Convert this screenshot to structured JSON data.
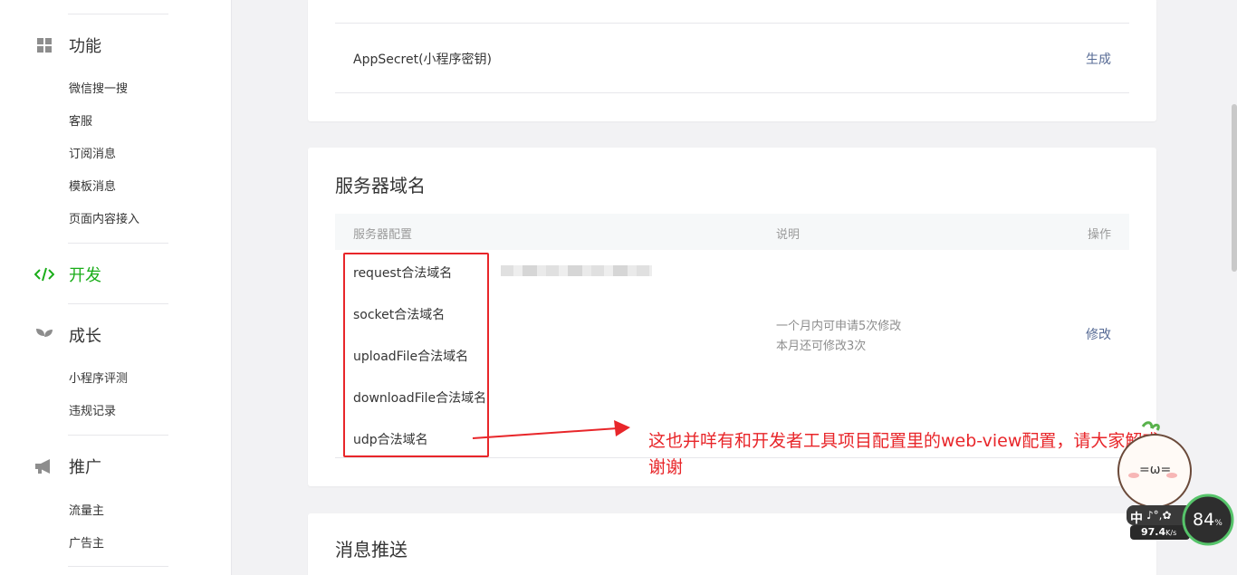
{
  "sidebar": {
    "sections": [
      {
        "label": "功能",
        "icon": "grid-icon"
      },
      {
        "label": "开发",
        "icon": "code-icon"
      },
      {
        "label": "成长",
        "icon": "sprout-icon"
      },
      {
        "label": "推广",
        "icon": "megaphone-icon"
      }
    ],
    "function_items": [
      "微信搜一搜",
      "客服",
      "订阅消息",
      "模板消息",
      "页面内容接入"
    ],
    "growth_items": [
      "小程序评测",
      "违规记录"
    ],
    "promo_items": [
      "流量主",
      "广告主"
    ]
  },
  "developer_settings": {
    "appsecret_label": "AppSecret(小程序密钥)",
    "generate_link": "生成"
  },
  "server_domain": {
    "title": "服务器域名",
    "headers": {
      "config": "服务器配置",
      "desc": "说明",
      "action": "操作"
    },
    "rows": [
      "request合法域名",
      "socket合法域名",
      "uploadFile合法域名",
      "downloadFile合法域名",
      "udp合法域名"
    ],
    "desc_line1": "一个月内可申请5次修改",
    "desc_line2": "本月还可修改3次",
    "modify_link": "修改"
  },
  "annotation": {
    "text": "这也并咩有和开发者工具项目配置里的web-view配置，请大家解惑，谢谢",
    "color": "#e8262a"
  },
  "message_push": {
    "title": "消息推送"
  },
  "widget": {
    "percent": "84",
    "percent_unit": "%",
    "speed": "97.4",
    "speed_unit": "K/s",
    "ime_text": "中"
  },
  "colors": {
    "accent": "#1aad19",
    "link": "#576b95",
    "annotation": "#e8262a"
  }
}
